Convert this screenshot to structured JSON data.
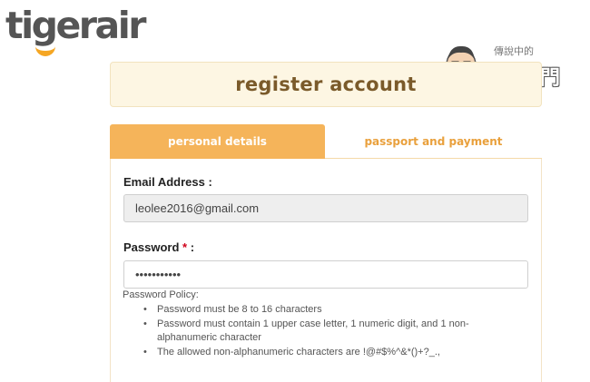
{
  "brand": {
    "logo_text": "tigerair",
    "accent_color": "#f5a623"
  },
  "watermark": {
    "small_text": "傳說中的",
    "big_text": "挨踢部門"
  },
  "page": {
    "title": "register account"
  },
  "tabs": [
    {
      "label": "personal details",
      "active": true
    },
    {
      "label": "passport and payment",
      "active": false
    }
  ],
  "form": {
    "email": {
      "label": "Email Address :",
      "value": "leolee2016@gmail.com"
    },
    "password": {
      "label": "Password",
      "required_mark": "*",
      "label_suffix": " :",
      "value": "•••••••••••"
    },
    "policy": {
      "title": "Password Policy:",
      "rules": [
        "Password must be 8 to 16 characters",
        "Password must contain 1 upper case letter, 1 numeric digit, and 1 non-alphanumeric character",
        "The allowed non-alphanumeric characters are !@#$%^&*()+?_.,"
      ]
    }
  }
}
